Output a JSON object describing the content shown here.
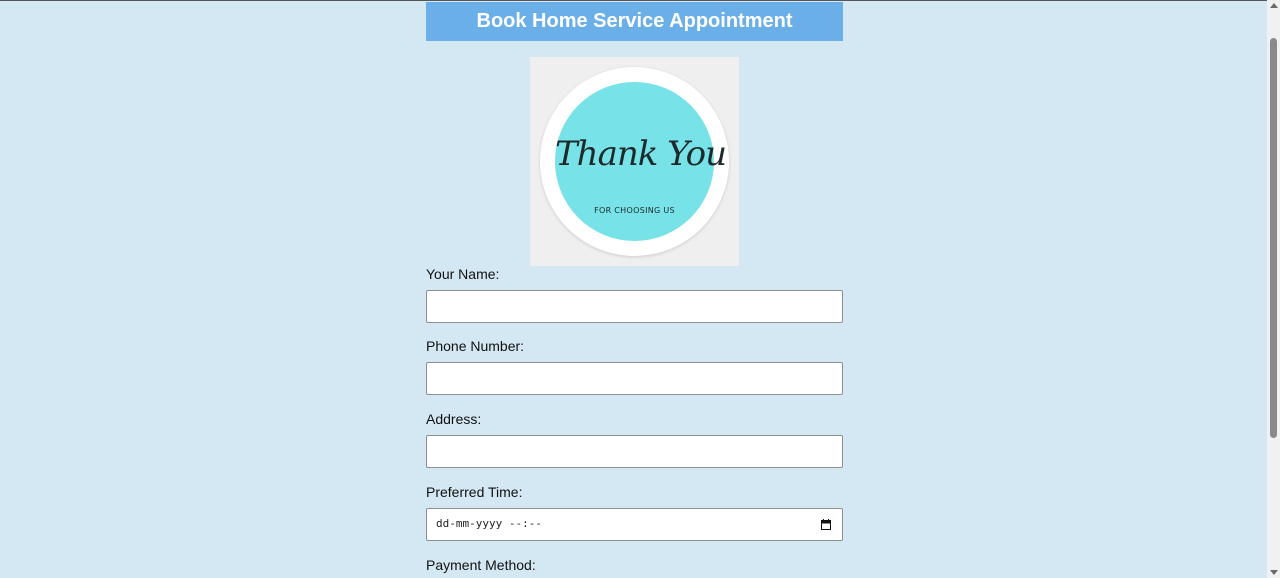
{
  "header": {
    "title": "Book Home Service Appointment"
  },
  "logo": {
    "script_text": "Thank You",
    "subtext": "FOR CHOOSING US",
    "ring_color": "#77e2e7"
  },
  "form": {
    "name_label": "Your Name:",
    "name_value": "",
    "phone_label": "Phone Number:",
    "phone_value": "",
    "address_label": "Address:",
    "address_value": "",
    "time_label": "Preferred Time:",
    "time_placeholder": "dd-mm-yyyy --:--",
    "payment_label": "Payment Method:"
  },
  "colors": {
    "background": "#d4e8f4",
    "header": "#6aafe8"
  }
}
